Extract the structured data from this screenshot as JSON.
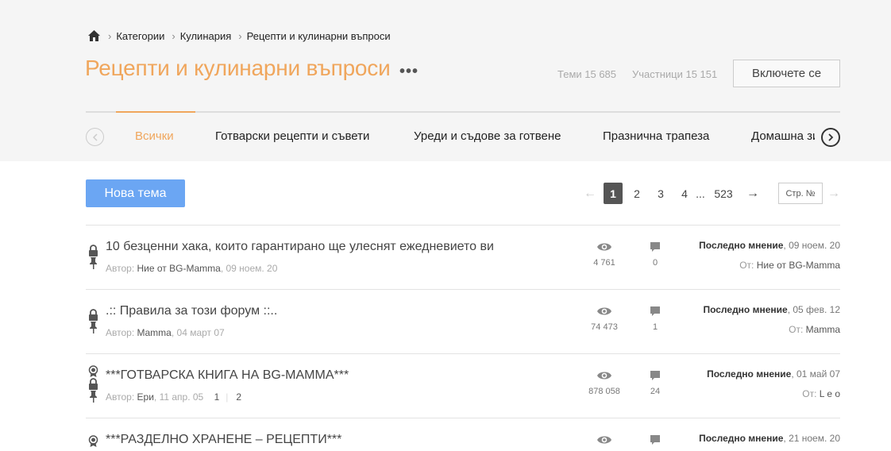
{
  "breadcrumb": {
    "items": [
      "Категории",
      "Кулинария",
      "Рецепти и кулинарни въпроси"
    ]
  },
  "header": {
    "title": "Рецепти и кулинарни въпроси",
    "more": "•••",
    "topics_stat": "Теми 15 685",
    "members_stat": "Участници 15 151",
    "join_label": "Включете се"
  },
  "tabs": {
    "items": [
      "Всички",
      "Готварски рецепти и съвети",
      "Уреди и съдове за готвене",
      "Празнична трапеза",
      "Домашна зимнина"
    ],
    "active_index": 0
  },
  "toolbar": {
    "new_topic_label": "Нова тема",
    "pager": {
      "prev": "←",
      "current": "1",
      "p2": "2",
      "p3": "3",
      "p4": "4",
      "ellipsis": "...",
      "last": "523",
      "next": "→"
    },
    "page_input_placeholder": "Стр. №",
    "go": "→"
  },
  "topics": [
    {
      "title": "10 безценни хака, които гарантирано ще улеснят ежедневието ви",
      "author_prefix": "Автор:",
      "author": "Ние от BG-Mamma",
      "date": ", 09 ноем. 20",
      "views": "4 761",
      "replies": "0",
      "last_label": "Последно мнение",
      "last_date": ", 09 ноем. 20",
      "last_by_prefix": "От:",
      "last_by": "Ние от BG-Mamma",
      "icons": [
        "lock-icon",
        "pin-icon"
      ]
    },
    {
      "title": ".:: Правила за този форум ::..",
      "author_prefix": "Автор:",
      "author": "Mamma",
      "date": ", 04 март 07",
      "views": "74 473",
      "replies": "1",
      "last_label": "Последно мнение",
      "last_date": ", 05 фев. 12",
      "last_by_prefix": "От:",
      "last_by": "Mamma",
      "icons": [
        "lock-icon",
        "pin-icon"
      ]
    },
    {
      "title": "***ГОТВАРСКА КНИГА НА BG-MAMMA***",
      "author_prefix": "Автор:",
      "author": "Ери",
      "date": ", 11 апр. 05",
      "pages": [
        "1",
        "2"
      ],
      "views": "878 058",
      "replies": "24",
      "last_label": "Последно мнение",
      "last_date": ", 01 май 07",
      "last_by_prefix": "От:",
      "last_by": "L e o",
      "icons": [
        "award-icon",
        "lock-icon",
        "pin-icon"
      ]
    },
    {
      "title": "***РАЗДЕЛНО ХРАНЕНЕ – РЕЦЕПТИ***",
      "last_label": "Последно мнение",
      "last_date": ", 21 ноем. 20",
      "icons": [
        "award-icon"
      ]
    }
  ]
}
